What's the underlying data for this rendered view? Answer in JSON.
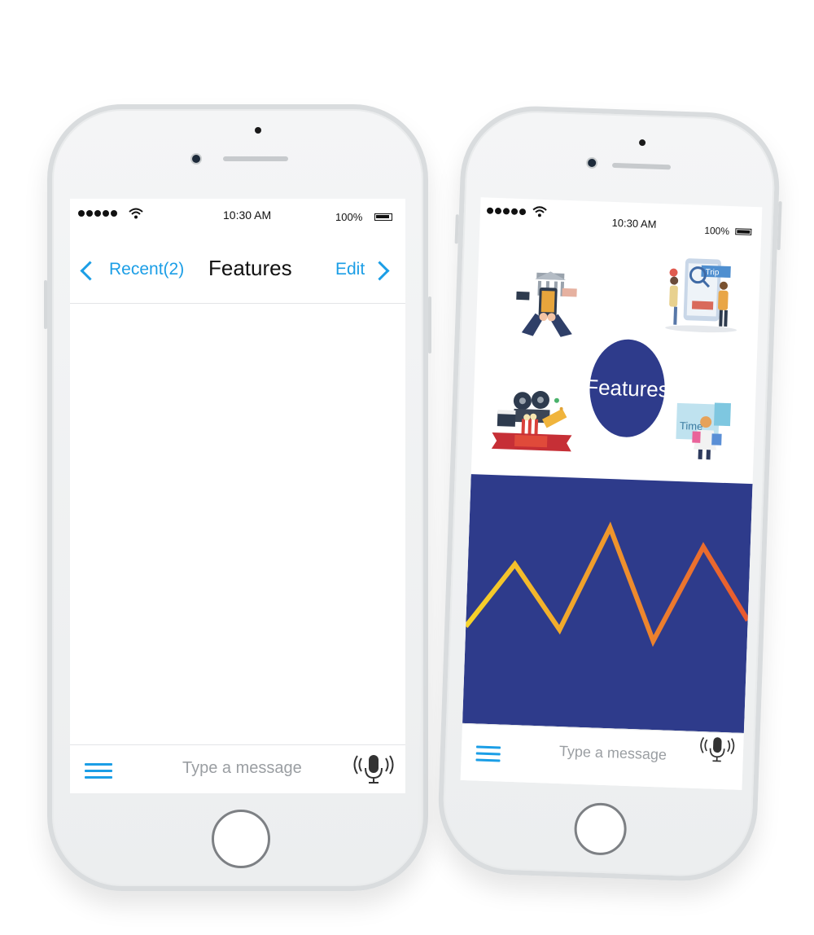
{
  "left_phone": {
    "status": {
      "time": "10:30 AM",
      "battery": "100%"
    },
    "nav": {
      "back_label": "Recent(2)",
      "title": "Features",
      "edit_label": "Edit"
    },
    "composer": {
      "placeholder": "Type a message"
    }
  },
  "right_phone": {
    "status": {
      "time": "10:30 AM",
      "battery": "100%"
    },
    "hub": {
      "center_label": "Features",
      "icons": [
        "banking-icon",
        "trip-planning-icon",
        "movie-cinema-icon",
        "shopping-time-icon"
      ],
      "trip_badge": "Trip",
      "shopping_badge": "Time"
    },
    "composer": {
      "placeholder": "Type a message"
    }
  },
  "chart_data": {
    "type": "line",
    "title": "",
    "xlabel": "",
    "ylabel": "",
    "x": [
      0,
      1,
      2,
      3,
      4,
      5,
      6
    ],
    "values": [
      0.3,
      0.7,
      0.3,
      0.95,
      0.25,
      0.85,
      0.4
    ],
    "ylim": [
      0,
      1
    ],
    "grid": false,
    "colors": {
      "background": "#2e3b8b",
      "line_start": "#f6d42a",
      "line_end": "#e8582f"
    }
  },
  "colors": {
    "accent": "#1b9ee6",
    "brand_blue": "#2e3b8b"
  }
}
